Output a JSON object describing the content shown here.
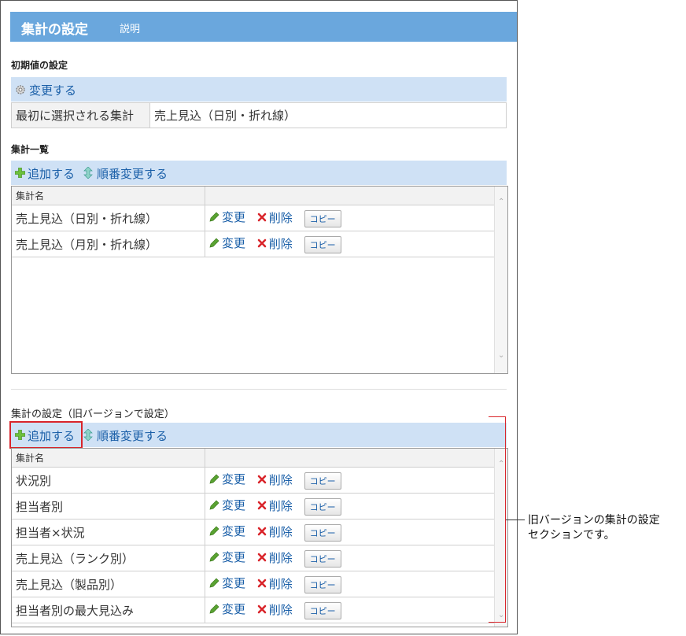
{
  "header": {
    "title": "集計の設定",
    "help": "説明"
  },
  "initial": {
    "label": "初期値の設定",
    "change_link": "変更する",
    "rows": [
      {
        "key": "最初に選択される集計",
        "value": "売上見込（日別・折れ線）"
      }
    ]
  },
  "list": {
    "label": "集計一覧",
    "add_link": "追加する",
    "reorder_link": "順番変更する",
    "column_header": "集計名",
    "rows": [
      {
        "name": "売上見込（日別・折れ線）"
      },
      {
        "name": "売上見込（月別・折れ線）"
      }
    ]
  },
  "legacy": {
    "label": "集計の設定（旧バージョンで設定）",
    "add_link": "追加する",
    "reorder_link": "順番変更する",
    "column_header": "集計名",
    "rows": [
      {
        "name": "状況別"
      },
      {
        "name": "担当者別"
      },
      {
        "name": "担当者×状況"
      },
      {
        "name": "売上見込（ランク別）"
      },
      {
        "name": "売上見込（製品別）"
      },
      {
        "name": "担当者別の最大見込み"
      }
    ]
  },
  "actions": {
    "edit": "変更",
    "delete": "削除",
    "copy": "コピー"
  },
  "annotation": {
    "line1": "旧バージョンの集計の設定",
    "line2": "セクションです。"
  },
  "colors": {
    "header": "#6aa7dd",
    "toolbar": "#cfe1f5",
    "link": "#1a5fa8",
    "annotation_red": "#d9252b"
  }
}
